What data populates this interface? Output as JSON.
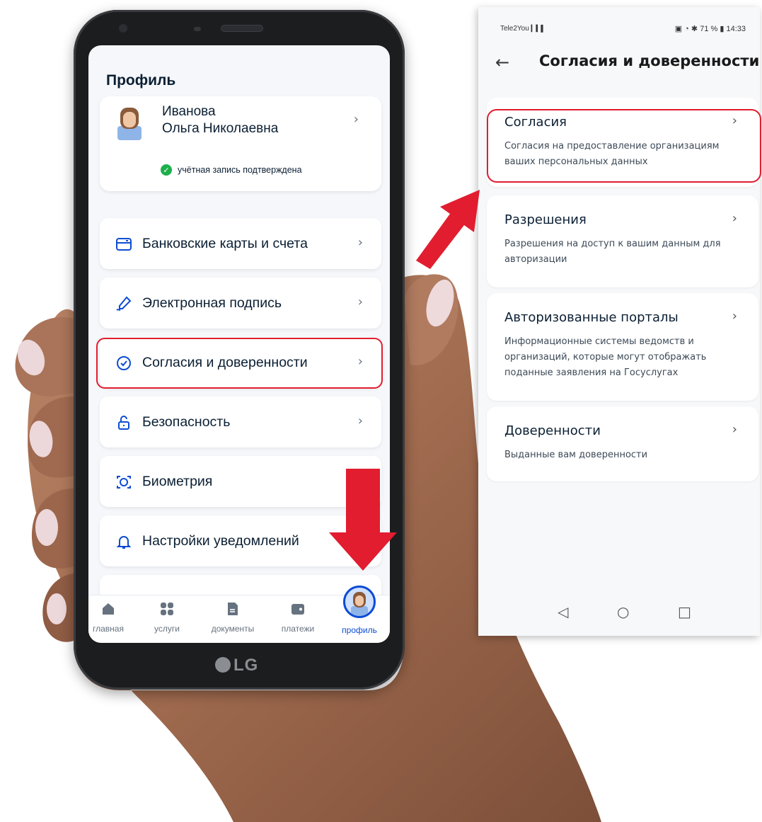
{
  "phone": {
    "brand": "LG",
    "screen_title": "Профиль",
    "user": {
      "last_name": "Иванова",
      "first_middle": "Ольга Николаевна",
      "status": "учётная запись подтверждена"
    },
    "menu": [
      {
        "label": "Банковские карты и счета",
        "icon": "bank-card-icon"
      },
      {
        "label": "Электронная подпись",
        "icon": "signature-pen-icon"
      },
      {
        "label": "Согласия и доверенности",
        "icon": "check-circle-icon"
      },
      {
        "label": "Безопасность",
        "icon": "lock-open-icon"
      },
      {
        "label": "Биометрия",
        "icon": "face-scan-icon"
      },
      {
        "label": "Настройки уведомлений",
        "icon": "bell-icon"
      }
    ],
    "tabs": [
      {
        "label": "главная",
        "icon": "home-icon"
      },
      {
        "label": "услуги",
        "icon": "grid-icon"
      },
      {
        "label": "документы",
        "icon": "document-icon"
      },
      {
        "label": "платежи",
        "icon": "wallet-icon"
      },
      {
        "label": "профиль",
        "icon": "profile-avatar-icon"
      }
    ],
    "active_tab": "профиль"
  },
  "panel": {
    "status_bar": {
      "carrier": "Tele2You",
      "battery": "71 %",
      "time": "14:33"
    },
    "title": "Согласия и доверенности",
    "cards": [
      {
        "title": "Согласия",
        "description": "Согласия на предоставление организациям ваших персональных данных"
      },
      {
        "title": "Разрешения",
        "description": "Разрешения на доступ к вашим данным для авторизации"
      },
      {
        "title": "Авторизованные порталы",
        "description": "Информационные системы ведомств и организаций, которые могут отображать поданные заявления на Госуслугах"
      },
      {
        "title": "Доверенности",
        "description": "Выданные вам доверенности"
      }
    ],
    "nav_buttons": [
      "back-triangle-icon",
      "home-circle-icon",
      "recent-square-icon"
    ]
  },
  "colors": {
    "highlight": "#e11d2f",
    "primary": "#0d4cd3",
    "verified": "#1cb04b",
    "text": "#0b1f33"
  }
}
